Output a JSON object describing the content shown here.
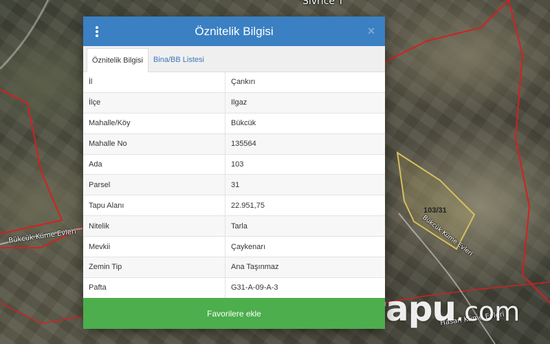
{
  "map": {
    "top_label": "Sivrice T",
    "road_labels": [
      "Bükcük Küme Evleri",
      "Bükcük Küme Evleri",
      "Hasan Küme Evleri"
    ],
    "parcel_label": "103/31",
    "boundary_color": "#d42020",
    "parcel_color": "#d8c060"
  },
  "watermark": {
    "main": "tapu",
    "suffix": ".com"
  },
  "modal": {
    "title": "Öznitelik Bilgisi",
    "menu_icon": "vertical-dots-icon",
    "close_icon": "×",
    "header_color": "#3a80c2",
    "tabs": [
      {
        "label": "Öznitelik Bilgisi",
        "active": true
      },
      {
        "label": "Bina/BB Listesi",
        "active": false
      }
    ],
    "rows": [
      {
        "key": "İl",
        "value": "Çankırı"
      },
      {
        "key": "İlçe",
        "value": "Ilgaz"
      },
      {
        "key": "Mahalle/Köy",
        "value": "Bükcük"
      },
      {
        "key": "Mahalle No",
        "value": "135564"
      },
      {
        "key": "Ada",
        "value": "103"
      },
      {
        "key": "Parsel",
        "value": "31"
      },
      {
        "key": "Tapu Alanı",
        "value": "22.951,75"
      },
      {
        "key": "Nitelik",
        "value": "Tarla"
      },
      {
        "key": "Mevkii",
        "value": "Çaykenarı"
      },
      {
        "key": "Zemin Tip",
        "value": "Ana Taşınmaz"
      },
      {
        "key": "Pafta",
        "value": "G31-A-09-A-3"
      }
    ],
    "favorite_button": "Favorilere ekle",
    "favorite_color": "#4cae4c"
  }
}
